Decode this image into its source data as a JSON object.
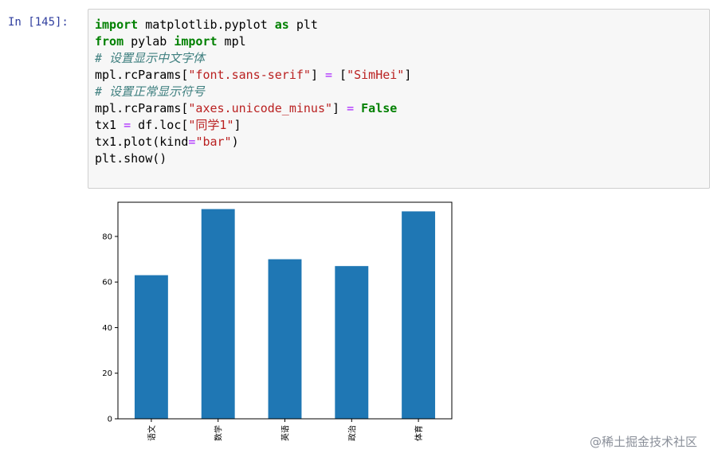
{
  "cell": {
    "prompt": "In  [145]:",
    "lines": [
      [
        {
          "t": "import",
          "c": "kw"
        },
        {
          "t": " matplotlib.pyplot ",
          "c": "plain"
        },
        {
          "t": "as",
          "c": "kw"
        },
        {
          "t": " plt",
          "c": "plain"
        }
      ],
      [
        {
          "t": "from",
          "c": "kw"
        },
        {
          "t": " pylab ",
          "c": "plain"
        },
        {
          "t": "import",
          "c": "kw"
        },
        {
          "t": " mpl",
          "c": "plain"
        }
      ],
      [
        {
          "t": "# 设置显示中文字体",
          "c": "cm"
        }
      ],
      [
        {
          "t": "mpl.rcParams[",
          "c": "plain"
        },
        {
          "t": "\"font.sans-serif\"",
          "c": "str"
        },
        {
          "t": "] ",
          "c": "plain"
        },
        {
          "t": "=",
          "c": "op"
        },
        {
          "t": " [",
          "c": "plain"
        },
        {
          "t": "\"SimHei\"",
          "c": "str"
        },
        {
          "t": "]",
          "c": "plain"
        }
      ],
      [
        {
          "t": "# 设置正常显示符号",
          "c": "cm"
        }
      ],
      [
        {
          "t": "mpl.rcParams[",
          "c": "plain"
        },
        {
          "t": "\"axes.unicode_minus\"",
          "c": "str"
        },
        {
          "t": "] ",
          "c": "plain"
        },
        {
          "t": "=",
          "c": "op"
        },
        {
          "t": " ",
          "c": "plain"
        },
        {
          "t": "False",
          "c": "kw"
        }
      ],
      [
        {
          "t": "tx1 ",
          "c": "plain"
        },
        {
          "t": "=",
          "c": "op"
        },
        {
          "t": " df.loc[",
          "c": "plain"
        },
        {
          "t": "\"同学1\"",
          "c": "str"
        },
        {
          "t": "]",
          "c": "plain"
        }
      ],
      [
        {
          "t": "tx1.plot(kind",
          "c": "plain"
        },
        {
          "t": "=",
          "c": "op"
        },
        {
          "t": "\"bar\"",
          "c": "str"
        },
        {
          "t": ")",
          "c": "plain"
        }
      ],
      [
        {
          "t": "plt.show()",
          "c": "plain"
        }
      ]
    ]
  },
  "chart_data": {
    "type": "bar",
    "categories": [
      "语文",
      "数学",
      "英语",
      "政治",
      "体育"
    ],
    "values": [
      63,
      92,
      70,
      67,
      91
    ],
    "ylim": [
      0,
      95
    ],
    "yticks": [
      0,
      20,
      40,
      60,
      80
    ],
    "bar_color": "#1f77b4",
    "grid": false
  },
  "watermark": "@稀土掘金技术社区"
}
